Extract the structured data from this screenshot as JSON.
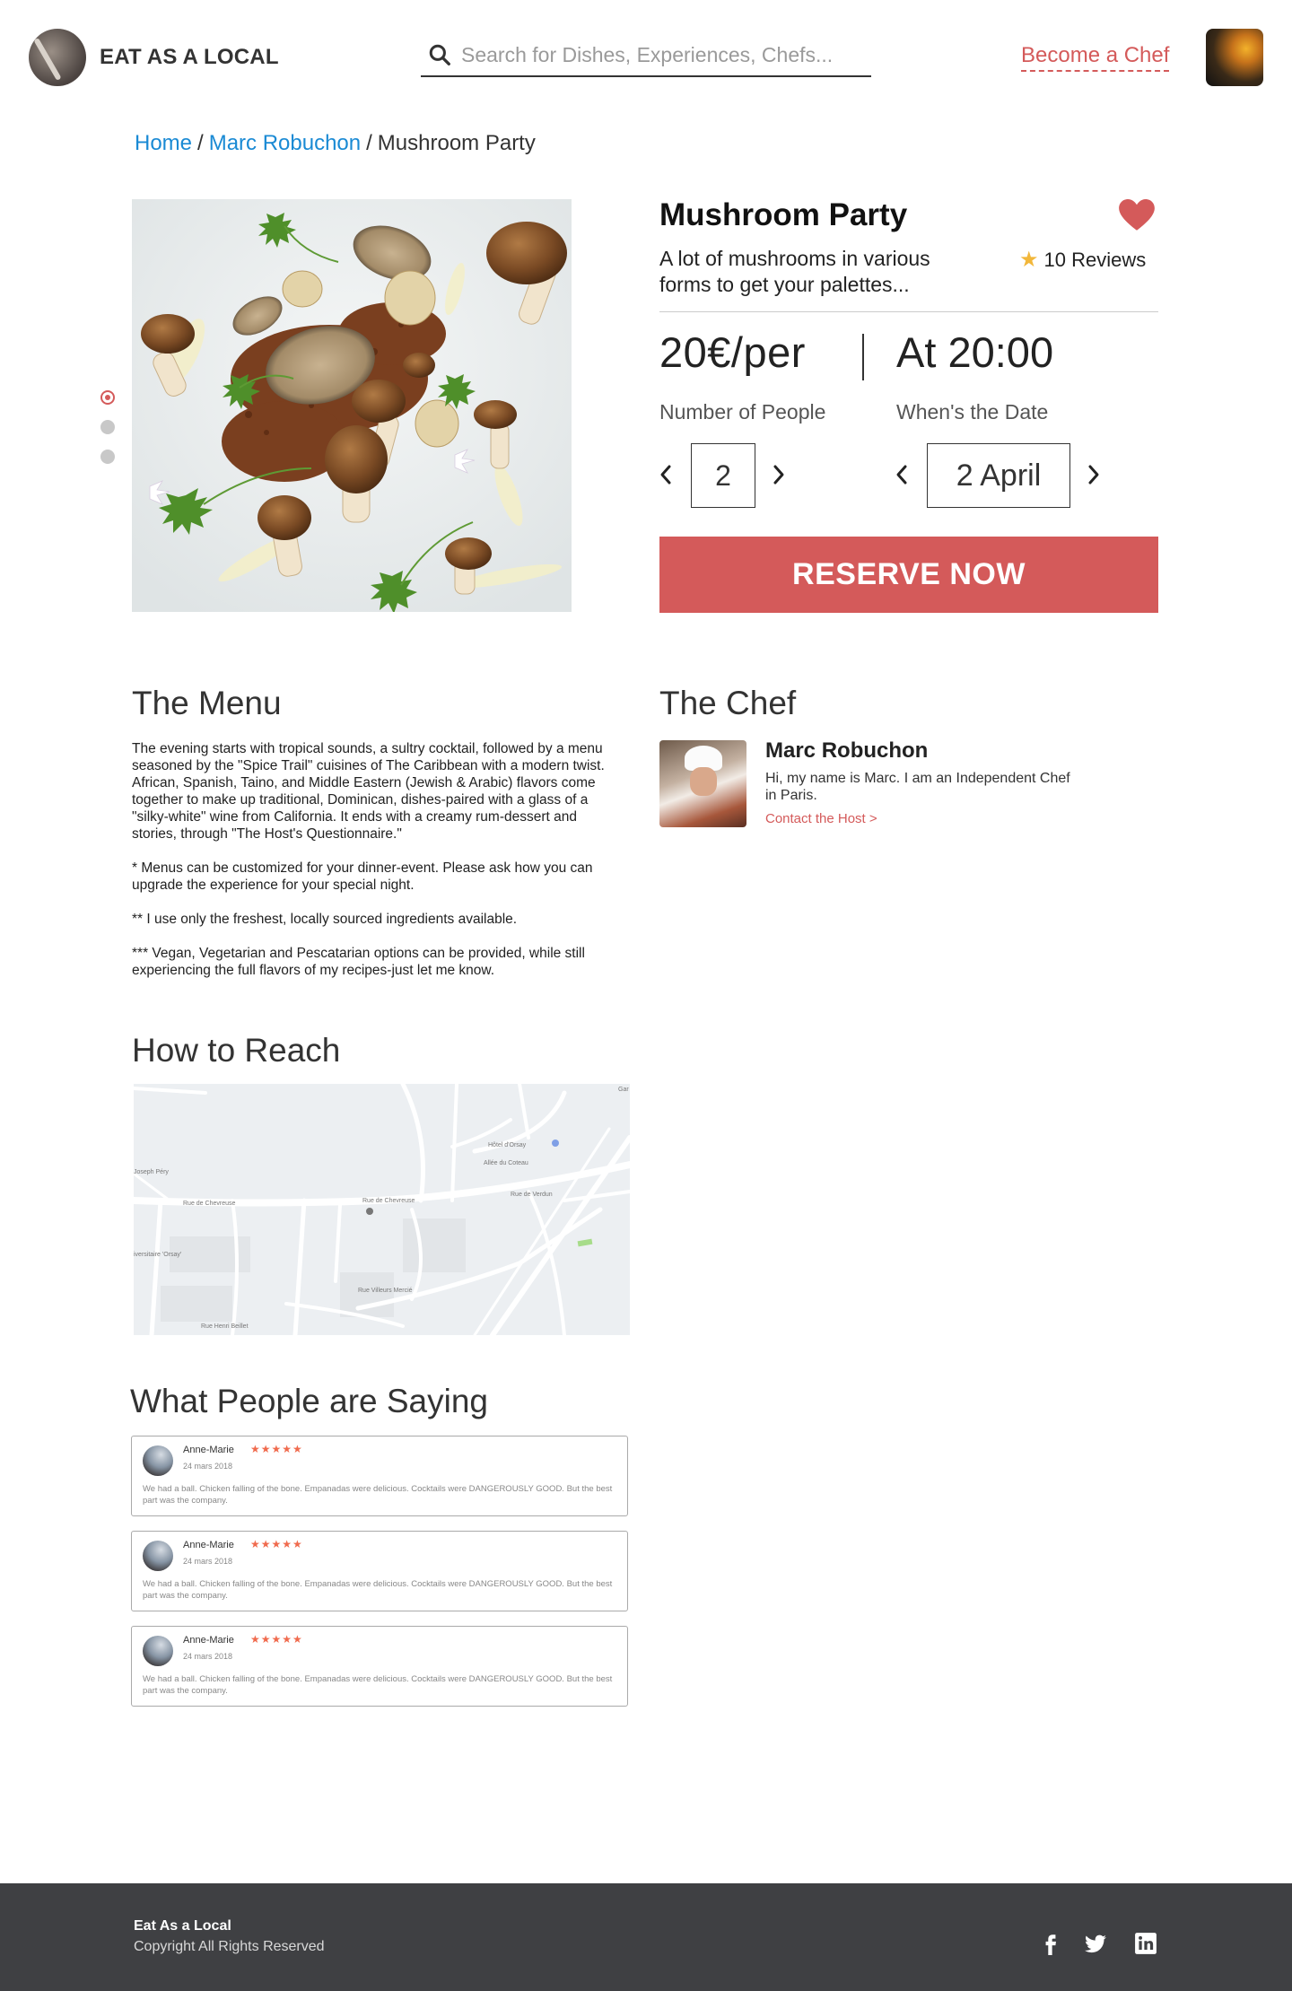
{
  "header": {
    "brand": "EAT AS A LOCAL",
    "search_placeholder": "Search for Dishes, Experiences, Chefs...",
    "become_chef": "Become a Chef"
  },
  "breadcrumb": {
    "home": "Home",
    "chef": "Marc Robuchon",
    "current": "Mushroom Party",
    "separator": "/"
  },
  "carousel": {
    "count": 3,
    "active_index": 0
  },
  "product": {
    "title": "Mushroom Party",
    "description": "A lot of mushrooms in various forms to get your palettes...",
    "reviews_label": "10 Reviews",
    "price": "20€/per",
    "time": "At 20:00",
    "people_label": "Number of People",
    "people_value": "2",
    "date_label": "When's the Date",
    "date_value": "2 April",
    "reserve_label": "RESERVE NOW",
    "favorited": true
  },
  "menu": {
    "heading": "The Menu",
    "paragraphs": [
      "The evening starts with tropical sounds, a sultry cocktail, followed by a menu seasoned by the \"Spice Trail\" cuisines of The Caribbean with a modern twist. African, Spanish, Taino, and Middle Eastern (Jewish & Arabic) flavors come together to make up traditional, Dominican, dishes-paired with a glass of a \"silky-white\" wine from California. It ends with a creamy rum-dessert and stories, through \"The Host's Questionnaire.\"",
      "* Menus can be customized for your dinner-event. Please ask how you can upgrade the experience for your special night.",
      "** I use only the freshest, locally sourced ingredients available.",
      "*** Vegan, Vegetarian and Pescatarian options can be provided, while still experiencing the full flavors of my recipes-just let me know."
    ]
  },
  "chef": {
    "heading": "The Chef",
    "name": "Marc Robuchon",
    "bio": "Hi, my name is Marc. I am an Independent Chef in Paris.",
    "contact": "Contact the Host >"
  },
  "reach": {
    "heading": "How to Reach",
    "map_labels": {
      "hotel": "Hôtel d'Orsay",
      "allee": "Allée du Coteau",
      "rue_chevreuse_1": "Rue de Chevreuse",
      "rue_chevreuse_2": "Rue de Chevreuse",
      "rue_verdun": "Rue de Verdun",
      "rue_villeurs": "Rue Villeurs Mercié",
      "rue_henri": "Rue Henri Beillet",
      "joseph": "Joseph Péry",
      "universitaire": "iversitaire 'Orsay'",
      "gar": "Gar"
    }
  },
  "testimonials": {
    "heading": "What People are Saying",
    "items": [
      {
        "name": "Anne-Marie",
        "stars": "★★★★★",
        "date": "24 mars 2018",
        "text": "We had a ball. Chicken falling of the bone. Empanadas were delicious. Cocktails were DANGEROUSLY GOOD. But the best part was the company."
      },
      {
        "name": "Anne-Marie",
        "stars": "★★★★★",
        "date": "24 mars 2018",
        "text": "We had a ball. Chicken falling of the bone. Empanadas were delicious. Cocktails were DANGEROUSLY GOOD. But the best part was the company."
      },
      {
        "name": "Anne-Marie",
        "stars": "★★★★★",
        "date": "24 mars 2018",
        "text": "We had a ball. Chicken falling of the bone. Empanadas were delicious. Cocktails were DANGEROUSLY GOOD. But the best part was the company."
      }
    ]
  },
  "footer": {
    "name": "Eat As a Local",
    "copyright": "Copyright All Rights Reserved",
    "social": [
      "facebook-icon",
      "twitter-icon",
      "linkedin-icon"
    ]
  },
  "colors": {
    "accent": "#d45a5a",
    "link": "#1a8ad4",
    "star": "#f2b73a",
    "footer_bg": "#3f4043"
  }
}
